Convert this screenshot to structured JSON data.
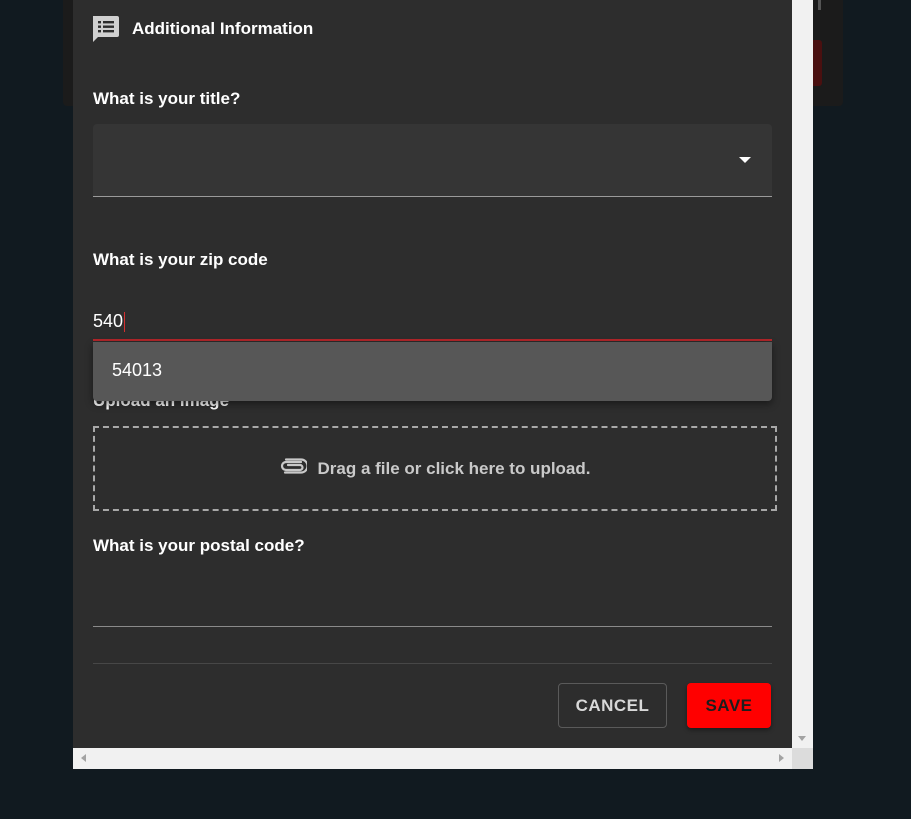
{
  "section": {
    "title": "Additional Information",
    "icon": "list-comment-icon"
  },
  "title_field": {
    "label": "What is your title?",
    "value": "",
    "icon": "dropdown-caret-icon"
  },
  "zip_field": {
    "label": "What is your zip code",
    "value": "540",
    "suggestion": "54013"
  },
  "upload_field": {
    "label": "Upload an image",
    "text": "Drag a file or click here to upload.",
    "icon": "paperclip-icon"
  },
  "postal_field": {
    "label": "What is your postal code?",
    "value": ""
  },
  "actions": {
    "cancel_label": "CANCEL",
    "save_label": "SAVE"
  },
  "colors": {
    "accent": "#ff0000",
    "focus_underline": "#b3262a",
    "surface": "#2d2d2d",
    "page_background": "#111a20"
  }
}
